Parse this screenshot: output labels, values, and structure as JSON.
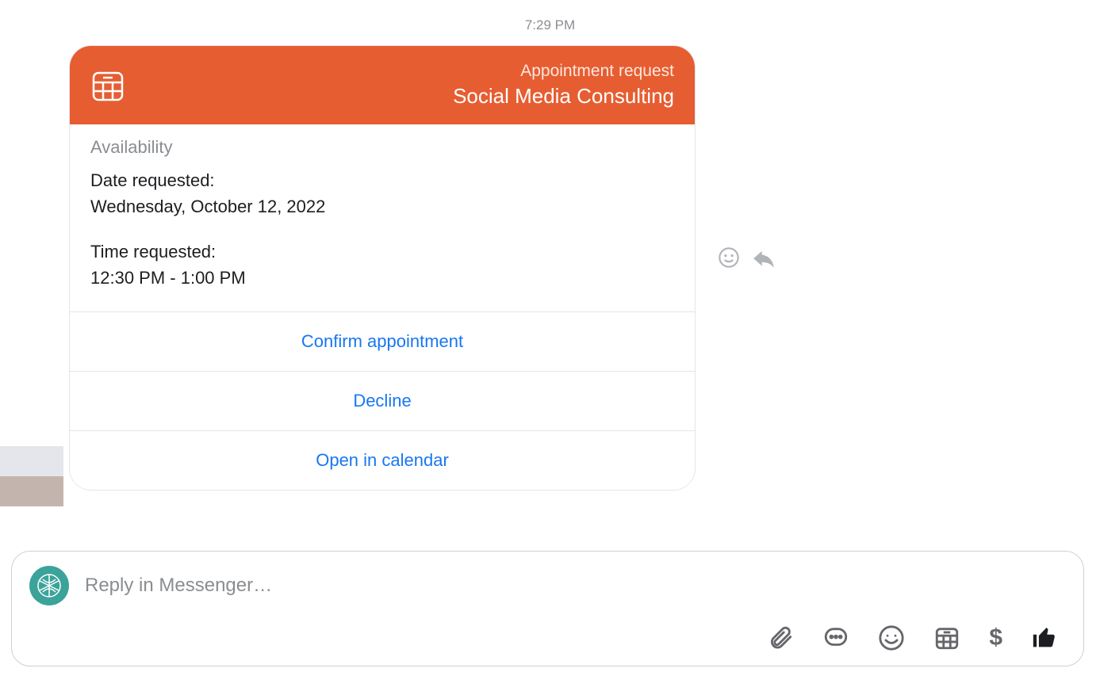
{
  "timestamp": "7:29 PM",
  "card": {
    "subtitle": "Appointment request",
    "title": "Social Media Consulting",
    "section_label": "Availability",
    "date_label": "Date requested:",
    "date_value": "Wednesday, October 12, 2022",
    "time_label": "Time requested:",
    "time_value": "12:30 PM - 1:00 PM",
    "actions": {
      "confirm": "Confirm appointment",
      "decline": "Decline",
      "open": "Open in calendar"
    }
  },
  "composer": {
    "placeholder": "Reply in Messenger…"
  },
  "toolbar": {
    "dollar": "$"
  }
}
